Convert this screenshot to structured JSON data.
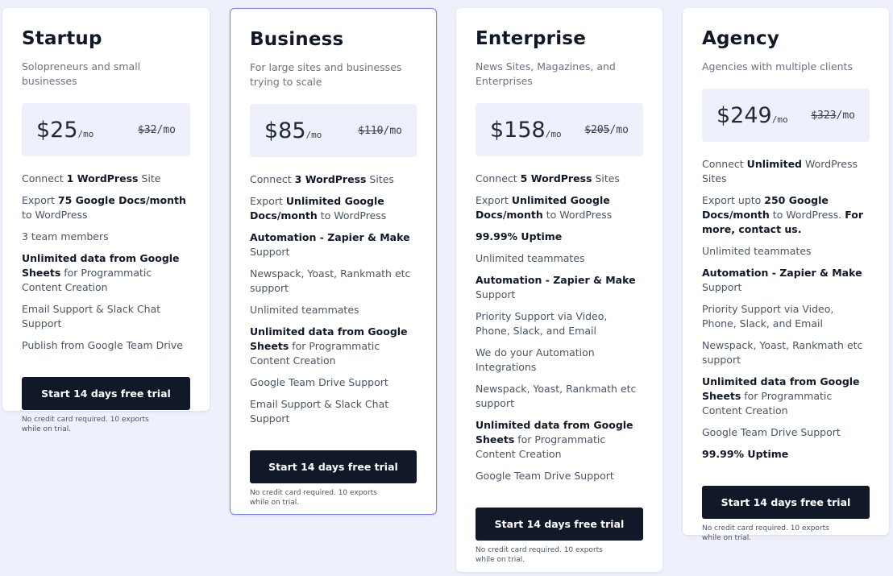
{
  "accent_color": "#7b7ff0",
  "plans": [
    {
      "name": "Startup",
      "description": "Solopreneurs and small businesses",
      "price": "$25",
      "price_unit": "/mo",
      "old_price": "$32",
      "old_price_unit": "/mo",
      "featured": false,
      "features": [
        [
          {
            "t": "Connect "
          },
          {
            "t": "1 WordPress",
            "b": true
          },
          {
            "t": " Site"
          }
        ],
        [
          {
            "t": "Export "
          },
          {
            "t": "75 Google Docs/month",
            "b": true
          },
          {
            "t": " to WordPress"
          }
        ],
        [
          {
            "t": "3 team members"
          }
        ],
        [
          {
            "t": "Unlimited data from Google Sheets",
            "b": true
          },
          {
            "t": " for Programmatic Content Creation"
          }
        ],
        [
          {
            "t": "Email Support & Slack Chat Support"
          }
        ],
        [
          {
            "t": "Publish from Google Team Drive"
          }
        ]
      ],
      "cta_label": "Start 14 days free trial",
      "note": "No credit card required. 10 exports while on trial."
    },
    {
      "name": "Business",
      "description": "For large sites and businesses trying to scale",
      "price": "$85",
      "price_unit": "/mo",
      "old_price": "$110",
      "old_price_unit": "/mo",
      "featured": true,
      "features": [
        [
          {
            "t": "Connect "
          },
          {
            "t": "3 WordPress",
            "b": true
          },
          {
            "t": " Sites"
          }
        ],
        [
          {
            "t": "Export "
          },
          {
            "t": "Unlimited Google Docs/month",
            "b": true
          },
          {
            "t": " to WordPress"
          }
        ],
        [
          {
            "t": "Automation - Zapier & Make",
            "b": true
          },
          {
            "t": " Support"
          }
        ],
        [
          {
            "t": "Newspack, Yoast, Rankmath etc support"
          }
        ],
        [
          {
            "t": "Unlimited teammates"
          }
        ],
        [
          {
            "t": "Unlimited data from Google Sheets",
            "b": true
          },
          {
            "t": " for Programmatic Content Creation"
          }
        ],
        [
          {
            "t": "Google Team Drive Support"
          }
        ],
        [
          {
            "t": "Email Support & Slack Chat Support"
          }
        ]
      ],
      "cta_label": "Start 14 days free trial",
      "note": "No credit card required. 10 exports while on trial."
    },
    {
      "name": "Enterprise",
      "description": "News Sites, Magazines, and Enterprises",
      "price": "$158",
      "price_unit": "/mo",
      "old_price": "$205",
      "old_price_unit": "/mo",
      "featured": false,
      "features": [
        [
          {
            "t": "Connect "
          },
          {
            "t": "5 WordPress",
            "b": true
          },
          {
            "t": " Sites"
          }
        ],
        [
          {
            "t": "Export "
          },
          {
            "t": "Unlimited Google Docs/month",
            "b": true
          },
          {
            "t": " to WordPress"
          }
        ],
        [
          {
            "t": "99.99% Uptime",
            "b": true
          }
        ],
        [
          {
            "t": "Unlimited teammates"
          }
        ],
        [
          {
            "t": "Automation - Zapier & Make",
            "b": true
          },
          {
            "t": " Support"
          }
        ],
        [
          {
            "t": "Priority Support via Video, Phone, Slack, and Email"
          }
        ],
        [
          {
            "t": "We do your Automation Integrations"
          }
        ],
        [
          {
            "t": "Newspack, Yoast, Rankmath etc support"
          }
        ],
        [
          {
            "t": "Unlimited data from Google Sheets",
            "b": true
          },
          {
            "t": " for Programmatic Content Creation"
          }
        ],
        [
          {
            "t": "Google Team Drive Support"
          }
        ]
      ],
      "cta_label": "Start 14 days free trial",
      "note": "No credit card required. 10 exports while on trial."
    },
    {
      "name": "Agency",
      "description": "Agencies with multiple clients",
      "price": "$249",
      "price_unit": "/mo",
      "old_price": "$323",
      "old_price_unit": "/mo",
      "featured": false,
      "features": [
        [
          {
            "t": "Connect "
          },
          {
            "t": "Unlimited",
            "b": true
          },
          {
            "t": " WordPress Sites"
          }
        ],
        [
          {
            "t": "Export upto "
          },
          {
            "t": "250 Google Docs/month",
            "b": true
          },
          {
            "t": " to WordPress. "
          },
          {
            "t": "For more, contact us.",
            "b": true
          }
        ],
        [
          {
            "t": "Unlimited teammates"
          }
        ],
        [
          {
            "t": "Automation - Zapier & Make",
            "b": true
          },
          {
            "t": " Support"
          }
        ],
        [
          {
            "t": "Priority Support via Video, Phone, Slack, and Email"
          }
        ],
        [
          {
            "t": "Newspack, Yoast, Rankmath etc support"
          }
        ],
        [
          {
            "t": "Unlimited data from Google Sheets",
            "b": true
          },
          {
            "t": " for Programmatic Content Creation"
          }
        ],
        [
          {
            "t": "Google Team Drive Support"
          }
        ],
        [
          {
            "t": "99.99% Uptime",
            "b": true
          }
        ]
      ],
      "cta_label": "Start 14 days free trial",
      "note": "No credit card required. 10 exports while on trial."
    }
  ]
}
